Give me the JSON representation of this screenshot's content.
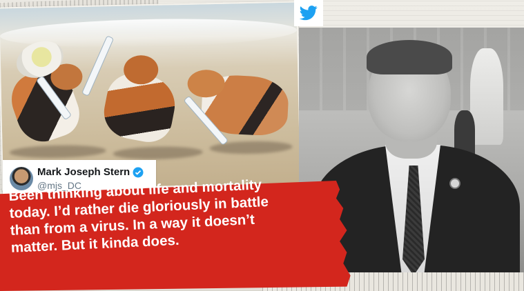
{
  "tweet": {
    "author_name": "Mark Joseph Stern",
    "handle": "@mjs_DC",
    "verified_icon": "verified-badge-icon",
    "text_lines": [
      "Been thinking about life and mortality",
      "today. I’d rather die gloriously in battle",
      "than from a virus.  In a way it doesn’t",
      "matter.  But it kinda does."
    ]
  },
  "icons": {
    "platform": "twitter-bird-icon",
    "avatar": "avatar"
  },
  "colors": {
    "banner_red": "#d3261d",
    "twitter_blue": "#1da1f2"
  }
}
